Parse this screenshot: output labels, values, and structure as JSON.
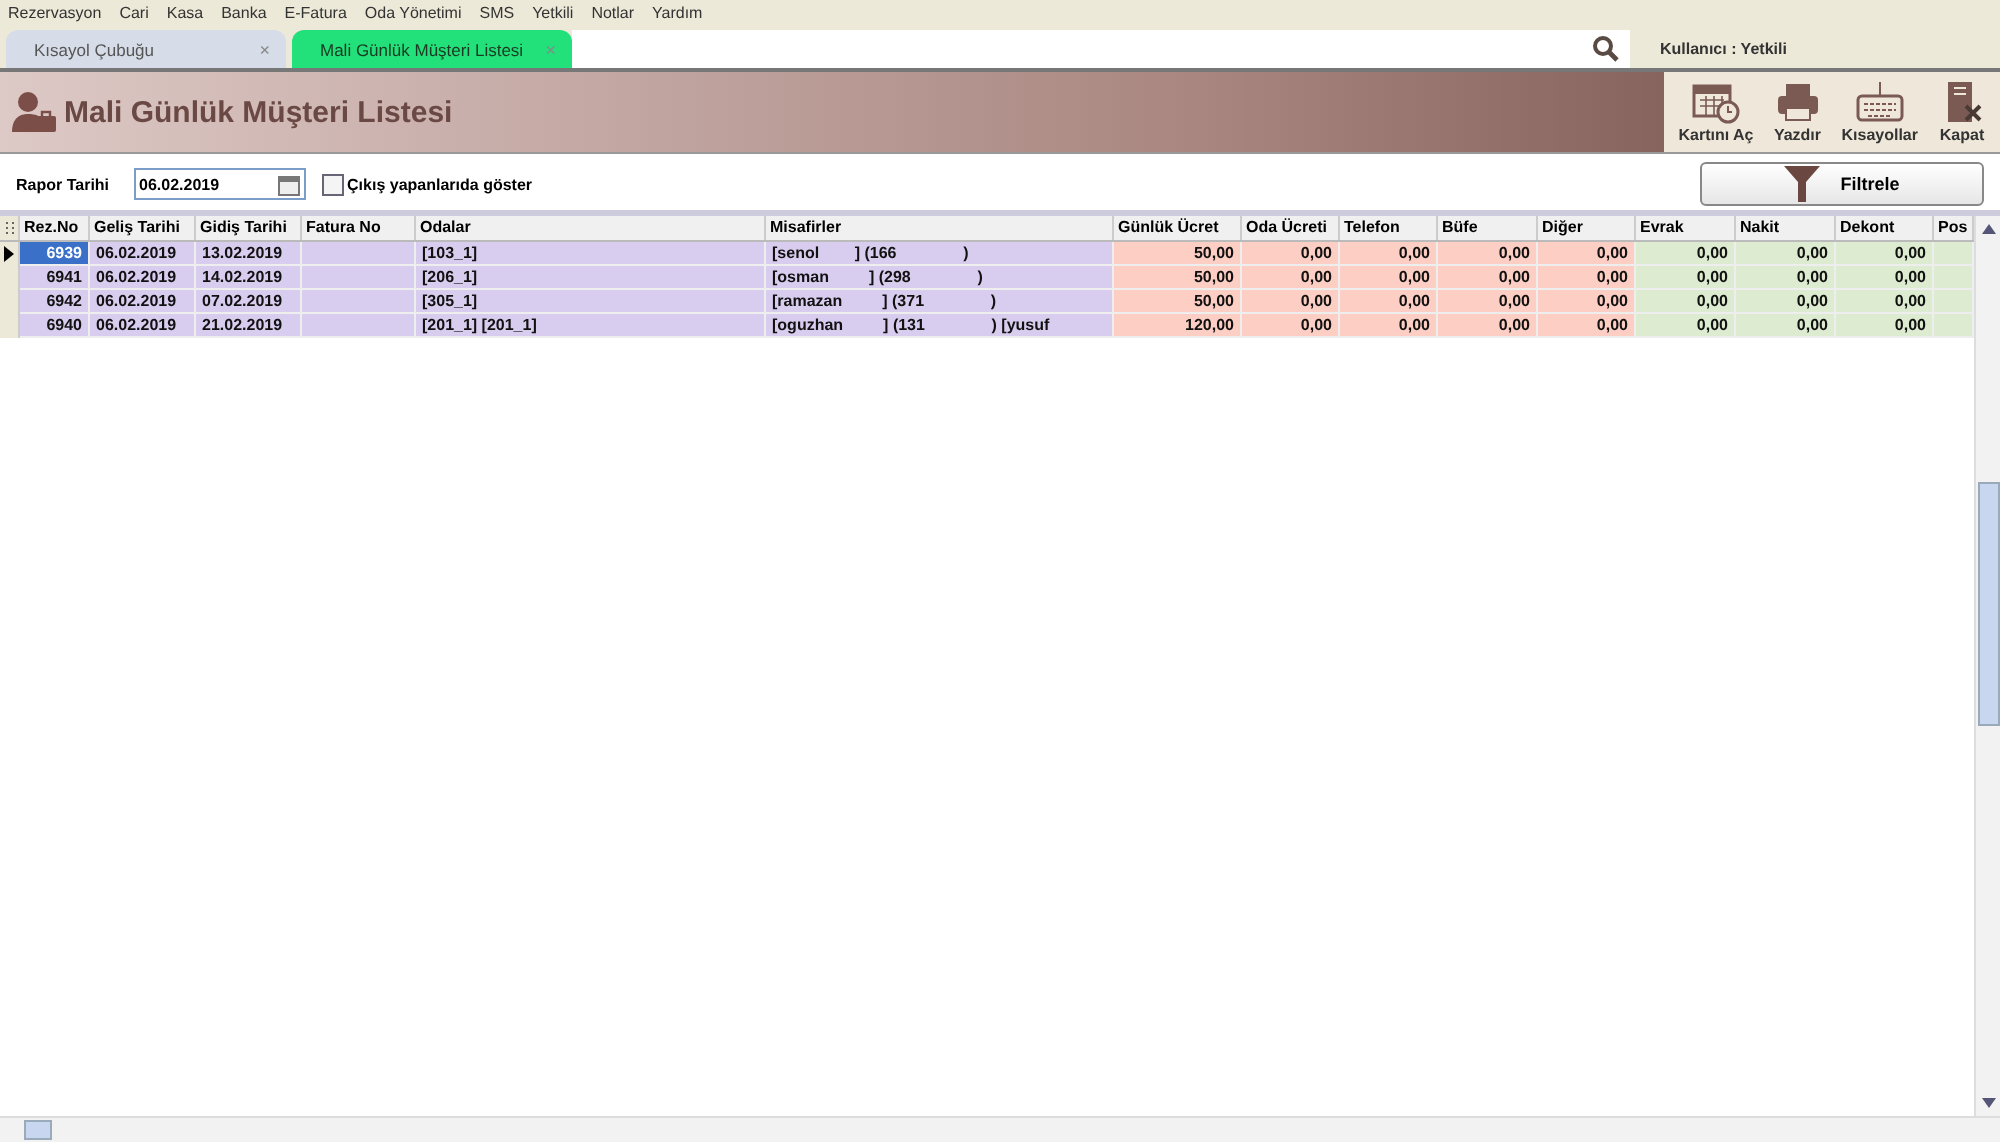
{
  "menu": [
    "Rezervasyon",
    "Cari",
    "Kasa",
    "Banka",
    "E-Fatura",
    "Oda Yönetimi",
    "SMS",
    "Yetkili",
    "Notlar",
    "Yardım"
  ],
  "tabs": [
    {
      "label": "Kısayol Çubuğu",
      "close": "×",
      "selected": false
    },
    {
      "label": "Mali Günlük Müşteri Listesi",
      "close": "×",
      "selected": true
    }
  ],
  "user": "Kullanıcı : Yetkili",
  "header": {
    "title": "Mali Günlük Müşteri Listesi",
    "actions": [
      {
        "label": "Kartını Aç",
        "kind": "calendar"
      },
      {
        "label": "Yazdır",
        "kind": "printer"
      },
      {
        "label": "Kısayollar",
        "kind": "keyboard"
      },
      {
        "label": "Kapat",
        "kind": "exit"
      }
    ]
  },
  "filter": {
    "date_label": "Rapor Tarihi",
    "date": "06.02.2019",
    "checkbox": {
      "label": "Çıkış yapanlarıda göster",
      "checked": false
    },
    "button": "Filtrele"
  },
  "table": {
    "columns": [
      {
        "label": "Rez.No",
        "kind": "guest"
      },
      {
        "label": "Geliş Tarihi",
        "kind": "guest"
      },
      {
        "label": "Gidiş Tarihi",
        "kind": "guest"
      },
      {
        "label": "Fatura No",
        "kind": "guest"
      },
      {
        "label": "Odalar",
        "kind": "guest"
      },
      {
        "label": "Misafirler",
        "kind": "guest"
      },
      {
        "label": "Günlük Ücret",
        "kind": "charge"
      },
      {
        "label": "Oda Ücreti",
        "kind": "charge"
      },
      {
        "label": "Telefon",
        "kind": "charge"
      },
      {
        "label": "Büfe",
        "kind": "charge"
      },
      {
        "label": "Diğer",
        "kind": "charge"
      },
      {
        "label": "Evrak",
        "kind": "payment"
      },
      {
        "label": "Nakit",
        "kind": "payment"
      },
      {
        "label": "Dekont",
        "kind": "payment"
      },
      {
        "label": "Pos",
        "kind": "payment"
      }
    ],
    "rows": [
      {
        "selected": true,
        "cells": [
          "6939",
          "06.02.2019",
          "13.02.2019",
          "",
          "[103_1]",
          "[senol        ] (166               )",
          "50,00",
          "0,00",
          "0,00",
          "0,00",
          "0,00",
          "0,00",
          "0,00",
          "0,00",
          ""
        ]
      },
      {
        "selected": false,
        "cells": [
          "6941",
          "06.02.2019",
          "14.02.2019",
          "",
          "[206_1]",
          "[osman         ] (298               )",
          "50,00",
          "0,00",
          "0,00",
          "0,00",
          "0,00",
          "0,00",
          "0,00",
          "0,00",
          ""
        ]
      },
      {
        "selected": false,
        "cells": [
          "6942",
          "06.02.2019",
          "07.02.2019",
          "",
          "[305_1]",
          "[ramazan         ] (371               )",
          "50,00",
          "0,00",
          "0,00",
          "0,00",
          "0,00",
          "0,00",
          "0,00",
          "0,00",
          ""
        ]
      },
      {
        "selected": false,
        "cells": [
          "6940",
          "06.02.2019",
          "21.02.2019",
          "",
          "[201_1] [201_1]",
          "[oguzhan         ] (131               ) [yusuf",
          "120,00",
          "0,00",
          "0,00",
          "0,00",
          "0,00",
          "0,00",
          "0,00",
          "0,00",
          ""
        ]
      }
    ]
  }
}
